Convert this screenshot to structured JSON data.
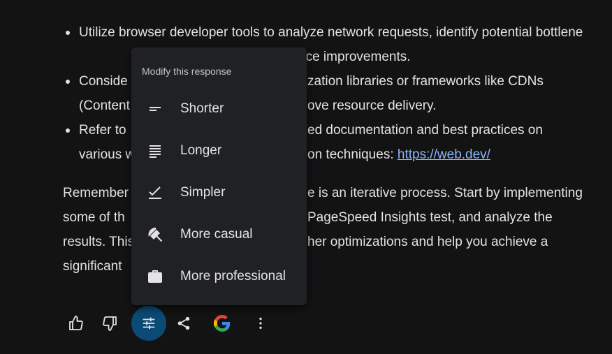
{
  "response": {
    "bullets": [
      {
        "text": "Utilize browser developer tools to analyze network requests, identify potential bottlene",
        "tail": "nce improvements."
      },
      {
        "text": "Conside",
        "mid": "zation libraries or frameworks like CDNs (Conten",
        "tail": "ove resource delivery."
      },
      {
        "text": "Refer to",
        "mid": "ed documentation and best practices on various w",
        "tail": "on techniques: ",
        "link": "https://web.dev/"
      }
    ],
    "paragraph": {
      "line1a": "Remember",
      "line1b": "e is an iterative process. Start by implementing",
      "line2a": "some of th",
      "line2b": "PageSpeed Insights test, and analyze the",
      "line3a": "results. This",
      "line3b": "her optimizations and help you achieve a",
      "line4a": "significant"
    }
  },
  "menu": {
    "title": "Modify this response",
    "items": [
      {
        "label": "Shorter",
        "icon": "shorter-icon"
      },
      {
        "label": "Longer",
        "icon": "longer-icon"
      },
      {
        "label": "Simpler",
        "icon": "simpler-icon"
      },
      {
        "label": "More casual",
        "icon": "casual-icon"
      },
      {
        "label": "More professional",
        "icon": "professional-icon"
      }
    ]
  },
  "toolbar": {
    "buttons": [
      "thumbs-up-icon",
      "thumbs-down-icon",
      "modify-response-icon",
      "share-icon",
      "google-icon",
      "more-options-icon"
    ],
    "active": "modify-response-icon",
    "accent": "#0b4a75"
  },
  "colors": {
    "background": "#131314",
    "text": "#e3e3e3",
    "link": "#8ab4f8",
    "menu": "#202124"
  }
}
